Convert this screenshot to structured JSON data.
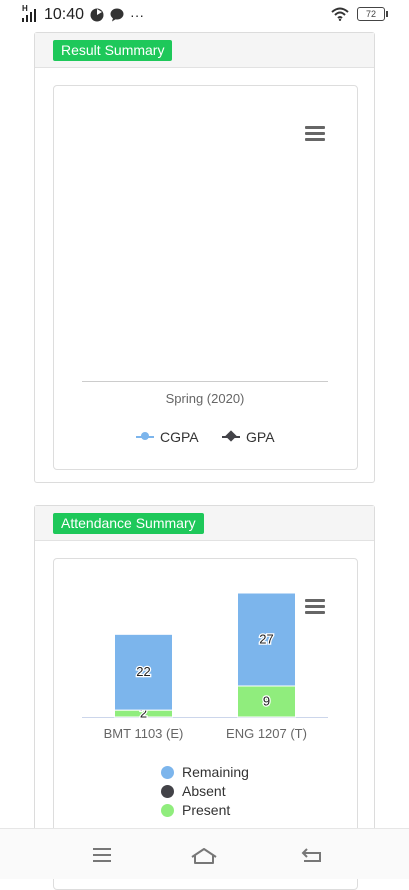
{
  "status_bar": {
    "time": "10:40",
    "network": "H",
    "more": "···",
    "battery": "72"
  },
  "result_summary": {
    "title": "Result Summary",
    "x_label": "Spring (2020)",
    "legend": [
      {
        "label": "CGPA",
        "color": "#7cb5ec"
      },
      {
        "label": "GPA",
        "color": "#434348"
      }
    ]
  },
  "attendance_summary": {
    "title": "Attendance Summary",
    "legend": [
      {
        "label": "Remaining",
        "color": "#7cb5ec"
      },
      {
        "label": "Absent",
        "color": "#434348"
      },
      {
        "label": "Present",
        "color": "#90ed7d"
      }
    ]
  },
  "chart_data": [
    {
      "type": "line",
      "categories": [
        "Spring (2020)"
      ],
      "series": [
        {
          "name": "CGPA",
          "values": []
        },
        {
          "name": "GPA",
          "values": []
        }
      ],
      "legend": "bottom"
    },
    {
      "type": "bar",
      "stacked": true,
      "categories": [
        "BMT 1103 (E)",
        "ENG 1207 (T)"
      ],
      "series": [
        {
          "name": "Remaining",
          "values": [
            22,
            27
          ],
          "color": "#7cb5ec"
        },
        {
          "name": "Absent",
          "values": [
            0,
            0
          ],
          "color": "#434348"
        },
        {
          "name": "Present",
          "values": [
            2,
            9
          ],
          "color": "#90ed7d"
        }
      ],
      "legend": "bottom"
    }
  ]
}
